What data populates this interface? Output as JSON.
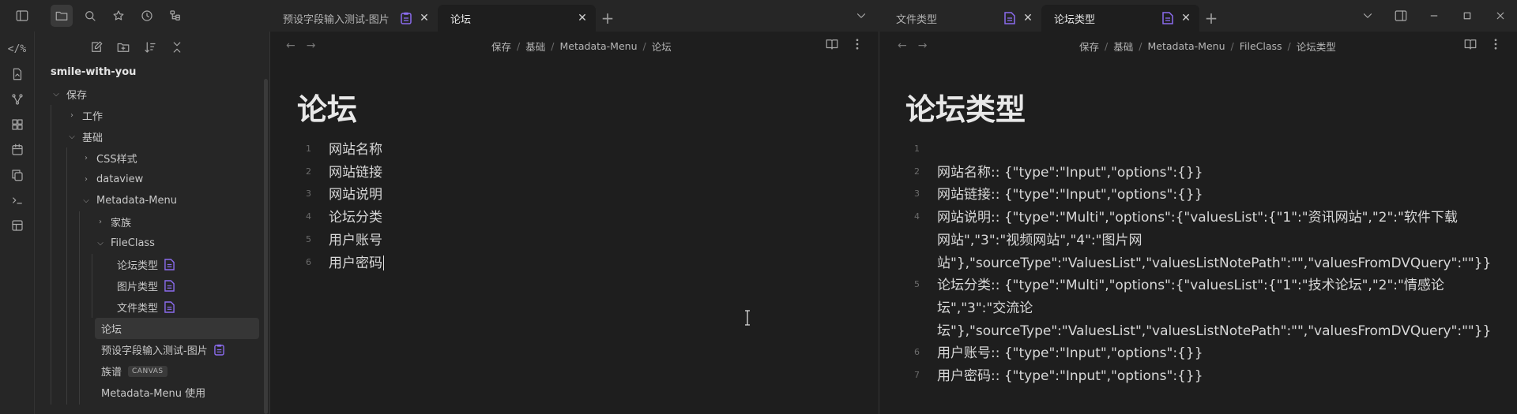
{
  "left_tabs": [
    {
      "label": "预设字段输入测试-图片",
      "active": false
    },
    {
      "label": "论坛",
      "active": true
    }
  ],
  "right_tabs": [
    {
      "label": "文件类型",
      "active": false
    },
    {
      "label": "论坛类型",
      "active": true
    }
  ],
  "ribbon_icons": [
    "code-percent-icon",
    "file-icon",
    "graph-icon",
    "grid-icon",
    "calendar-icon",
    "copy-icon",
    "terminal-icon",
    "template-icon"
  ],
  "explorer": {
    "vault_name": "smile-with-you",
    "tree": [
      {
        "label": "保存",
        "level": 0,
        "arrow": "down"
      },
      {
        "label": "工作",
        "level": 1,
        "arrow": "right"
      },
      {
        "label": "基础",
        "level": 1,
        "arrow": "down"
      },
      {
        "label": "CSS样式",
        "level": 2,
        "arrow": "right"
      },
      {
        "label": "dataview",
        "level": 2,
        "arrow": "right"
      },
      {
        "label": "Metadata-Menu",
        "level": 2,
        "arrow": "down"
      },
      {
        "label": "家族",
        "level": 3,
        "arrow": "right"
      },
      {
        "label": "FileClass",
        "level": 3,
        "arrow": "down"
      },
      {
        "label": "论坛类型",
        "level": 4,
        "arrow": "",
        "badge": "fileclass"
      },
      {
        "label": "图片类型",
        "level": 4,
        "arrow": "",
        "badge": "fileclass"
      },
      {
        "label": "文件类型",
        "level": 4,
        "arrow": "",
        "badge": "fileclass"
      },
      {
        "label": "论坛",
        "level": 3,
        "arrow": "",
        "selected": true
      },
      {
        "label": "预设字段输入测试-图片",
        "level": 3,
        "arrow": "",
        "badge": "form"
      },
      {
        "label": "族谱",
        "level": 3,
        "arrow": "",
        "canvas": "CANVAS"
      },
      {
        "label": "Metadata-Menu 使用",
        "level": 3,
        "arrow": ""
      }
    ]
  },
  "left_pane": {
    "breadcrumb": [
      "保存",
      "基础",
      "Metadata-Menu",
      "论坛"
    ],
    "title": "论坛",
    "lines": [
      {
        "n": "1",
        "text": "网站名称"
      },
      {
        "n": "2",
        "text": "网站链接"
      },
      {
        "n": "3",
        "text": "网站说明"
      },
      {
        "n": "4",
        "text": "论坛分类"
      },
      {
        "n": "5",
        "text": "用户账号"
      },
      {
        "n": "6",
        "text": "用户密码"
      }
    ]
  },
  "right_pane": {
    "breadcrumb": [
      "保存",
      "基础",
      "Metadata-Menu",
      "FileClass",
      "论坛类型"
    ],
    "title": "论坛类型",
    "lines": [
      {
        "n": "1",
        "text": ""
      },
      {
        "n": "2",
        "text": "网站名称:: {\"type\":\"Input\",\"options\":{}}"
      },
      {
        "n": "3",
        "text": "网站链接:: {\"type\":\"Input\",\"options\":{}}"
      },
      {
        "n": "4",
        "text": "网站说明:: {\"type\":\"Multi\",\"options\":{\"valuesList\":{\"1\":\"资讯网站\",\"2\":\"软件下载网站\",\"3\":\"视频网站\",\"4\":\"图片网站\"},\"sourceType\":\"ValuesList\",\"valuesListNotePath\":\"\",\"valuesFromDVQuery\":\"\"}}"
      },
      {
        "n": "5",
        "text": "论坛分类:: {\"type\":\"Multi\",\"options\":{\"valuesList\":{\"1\":\"技术论坛\",\"2\":\"情感论坛\",\"3\":\"交流论坛\"},\"sourceType\":\"ValuesList\",\"valuesListNotePath\":\"\",\"valuesFromDVQuery\":\"\"}}"
      },
      {
        "n": "6",
        "text": "用户账号:: {\"type\":\"Input\",\"options\":{}}"
      },
      {
        "n": "7",
        "text": "用户密码:: {\"type\":\"Input\",\"options\":{}}"
      }
    ]
  },
  "colors": {
    "accent": "#8b6cef",
    "background": "#1e1e1e",
    "sidebar": "#262626"
  }
}
